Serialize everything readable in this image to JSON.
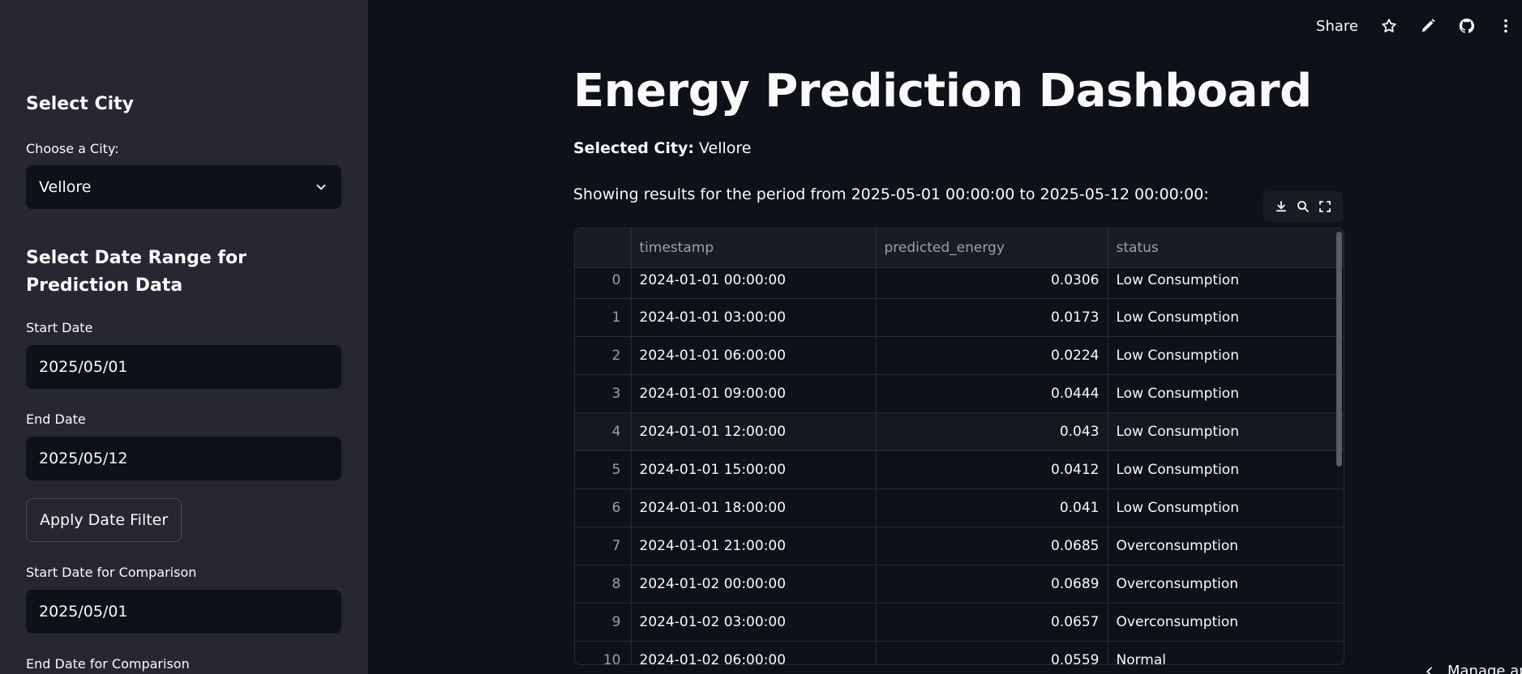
{
  "sidebar": {
    "city_heading": "Select City",
    "city_label": "Choose a City:",
    "city_value": "Vellore",
    "date_heading": "Select Date Range for Prediction Data",
    "start_label": "Start Date",
    "start_value": "2025/05/01",
    "end_label": "End Date",
    "end_value": "2025/05/12",
    "apply_button": "Apply Date Filter",
    "cmp_start_label": "Start Date for Comparison",
    "cmp_start_value": "2025/05/01",
    "cmp_end_label": "End Date for Comparison"
  },
  "topbar": {
    "share": "Share",
    "icons": [
      "star-icon",
      "pencil-icon",
      "github-icon",
      "more-vertical-icon"
    ]
  },
  "main": {
    "title": "Energy Prediction Dashboard",
    "city_prefix": "Selected City:",
    "city_value": "Vellore",
    "period_text": "Showing results for the period from 2025-05-01 00:00:00 to 2025-05-12 00:00:00:"
  },
  "table": {
    "columns": [
      "",
      "timestamp",
      "predicted_energy",
      "status"
    ],
    "rows": [
      {
        "idx": "0",
        "timestamp": "2024-01-01 00:00:00",
        "predicted_energy": "0.0306",
        "status": "Low Consumption"
      },
      {
        "idx": "1",
        "timestamp": "2024-01-01 03:00:00",
        "predicted_energy": "0.0173",
        "status": "Low Consumption"
      },
      {
        "idx": "2",
        "timestamp": "2024-01-01 06:00:00",
        "predicted_energy": "0.0224",
        "status": "Low Consumption"
      },
      {
        "idx": "3",
        "timestamp": "2024-01-01 09:00:00",
        "predicted_energy": "0.0444",
        "status": "Low Consumption"
      },
      {
        "idx": "4",
        "timestamp": "2024-01-01 12:00:00",
        "predicted_energy": "0.043",
        "status": "Low Consumption"
      },
      {
        "idx": "5",
        "timestamp": "2024-01-01 15:00:00",
        "predicted_energy": "0.0412",
        "status": "Low Consumption"
      },
      {
        "idx": "6",
        "timestamp": "2024-01-01 18:00:00",
        "predicted_energy": "0.041",
        "status": "Low Consumption"
      },
      {
        "idx": "7",
        "timestamp": "2024-01-01 21:00:00",
        "predicted_energy": "0.0685",
        "status": "Overconsumption"
      },
      {
        "idx": "8",
        "timestamp": "2024-01-02 00:00:00",
        "predicted_energy": "0.0689",
        "status": "Overconsumption"
      },
      {
        "idx": "9",
        "timestamp": "2024-01-02 03:00:00",
        "predicted_energy": "0.0657",
        "status": "Overconsumption"
      },
      {
        "idx": "10",
        "timestamp": "2024-01-02 06:00:00",
        "predicted_energy": "0.0559",
        "status": "Normal"
      }
    ]
  },
  "footer": {
    "manage": "Manage app"
  }
}
